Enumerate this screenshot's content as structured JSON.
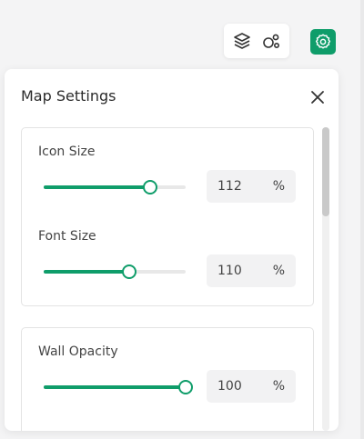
{
  "toolbar": {
    "layers_icon": "layers-icon",
    "nodes_icon": "nodes-icon",
    "settings_icon": "gear-icon"
  },
  "panel": {
    "title": "Map Settings",
    "close_icon": "close-icon",
    "settings": [
      {
        "label": "Icon Size",
        "value": "112",
        "unit": "%",
        "slider_percent": 75
      },
      {
        "label": "Font Size",
        "value": "110",
        "unit": "%",
        "slider_percent": 60
      },
      {
        "label": "Wall Opacity",
        "value": "100",
        "unit": "%",
        "slider_percent": 100
      }
    ]
  },
  "colors": {
    "accent": "#0f9d6a",
    "track": "#e8e8e8",
    "field_bg": "#f2f2f3"
  }
}
